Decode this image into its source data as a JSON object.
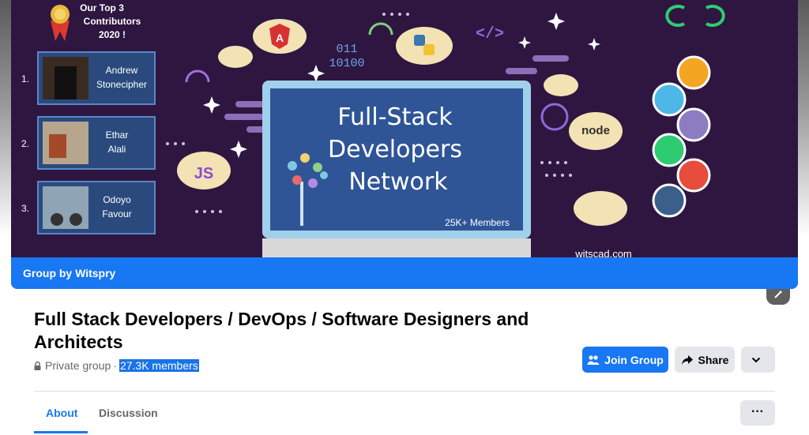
{
  "cover": {
    "top_heading_line1": "Our Top 3",
    "top_heading_line2": "Contributors",
    "top_heading_line3": "2020 !",
    "contributors": [
      {
        "rank": "1.",
        "first": "Andrew",
        "last": "Stonecipher"
      },
      {
        "rank": "2.",
        "first": "Ethar",
        "last": "Alali"
      },
      {
        "rank": "3.",
        "first": "Odoyo",
        "last": "Favour"
      }
    ],
    "screen_line1": "Full-Stack",
    "screen_line2": "Developers",
    "screen_line3": "Network",
    "screen_members": "25K+ Members",
    "brand": "witscad.com",
    "binary_line1": "011",
    "binary_line2": "10100",
    "code_tag": "</>",
    "js_label": "JS",
    "node_label": "node",
    "group_by": "Group by Witspry"
  },
  "group": {
    "title": "Full Stack Developers / DevOps / Software Designers and Architects",
    "privacy": "Private group",
    "separator": "·",
    "members": "27.3K members"
  },
  "actions": {
    "join_label": "Join Group",
    "share_label": "Share",
    "more_label": "⌄"
  },
  "tabs": {
    "about": "About",
    "discussion": "Discussion",
    "more": "···"
  },
  "colors": {
    "accent": "#1877f2",
    "cover_bg": "#2e1640"
  }
}
